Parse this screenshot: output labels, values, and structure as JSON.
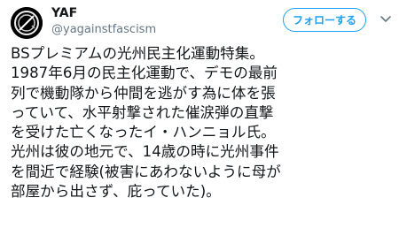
{
  "user": {
    "display_name": "YAF",
    "handle": "@yagainstfascism"
  },
  "follow_button": {
    "label": "フォローする"
  },
  "icons": {
    "avatar": "avatar-image",
    "menu": "chevron-down-icon"
  },
  "colors": {
    "accent": "#1da1f2",
    "text": "#14171a",
    "muted": "#657786"
  },
  "tweet": {
    "lines": [
      "BSプレミアムの光州民主化運動特集。",
      "1987年6月の民主化運動で、デモの最前",
      "列で機動隊から仲間を逃がす為に体を張",
      "っていて、水平射撃された催涙弾の直撃",
      "を受けた亡くなったイ・ハンニョル氏。",
      "光州は彼の地元で、14歳の時に光州事件",
      "を間近で経験(被害にあわないように母が",
      "部屋から出さず、庇っていた)。"
    ]
  }
}
